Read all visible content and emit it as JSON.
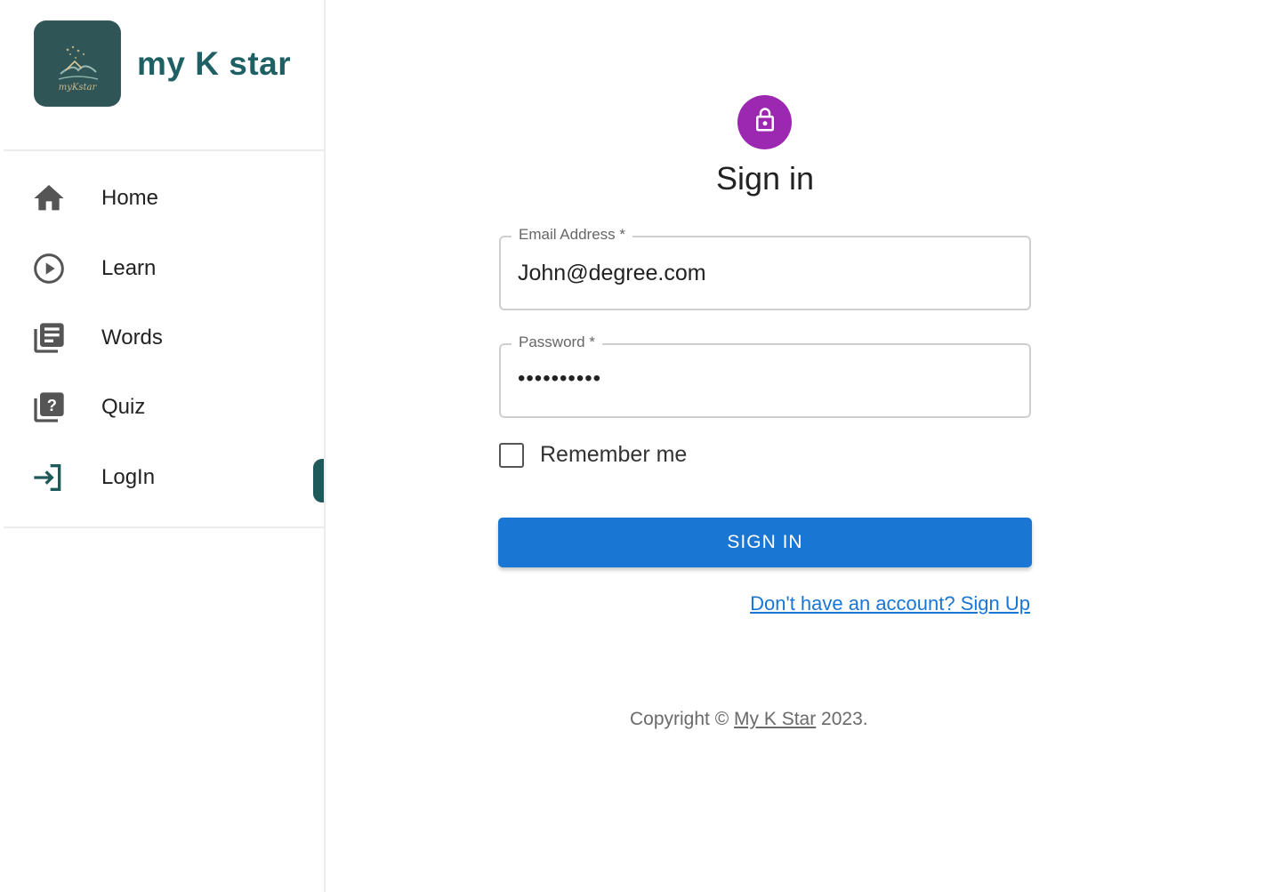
{
  "sidebar": {
    "brand_name": "my K star",
    "logo_text": "myKstar",
    "items": [
      {
        "label": "Home",
        "icon": "home-icon"
      },
      {
        "label": "Learn",
        "icon": "play-circle-icon"
      },
      {
        "label": "Words",
        "icon": "library-books-icon"
      },
      {
        "label": "Quiz",
        "icon": "quiz-icon"
      },
      {
        "label": "LogIn",
        "icon": "login-icon"
      }
    ],
    "active_item": "LogIn"
  },
  "main": {
    "avatar_icon": "lock-icon",
    "title": "Sign in",
    "email": {
      "label": "Email Address *",
      "value": "John@degree.com"
    },
    "password": {
      "label": "Password *",
      "value": "••••••••••"
    },
    "remember_label": "Remember me",
    "remember_checked": false,
    "submit_label": "SIGN IN",
    "signup_link": "Don't have an account? Sign Up",
    "copyright_prefix": "Copyright © ",
    "copyright_link": "My K Star",
    "copyright_suffix": " 2023."
  },
  "colors": {
    "brand": "#1f6064",
    "logo_bg": "#2f5556",
    "avatar": "#9c27b0",
    "primary": "#1976d2",
    "nav_icon": "#555555"
  }
}
